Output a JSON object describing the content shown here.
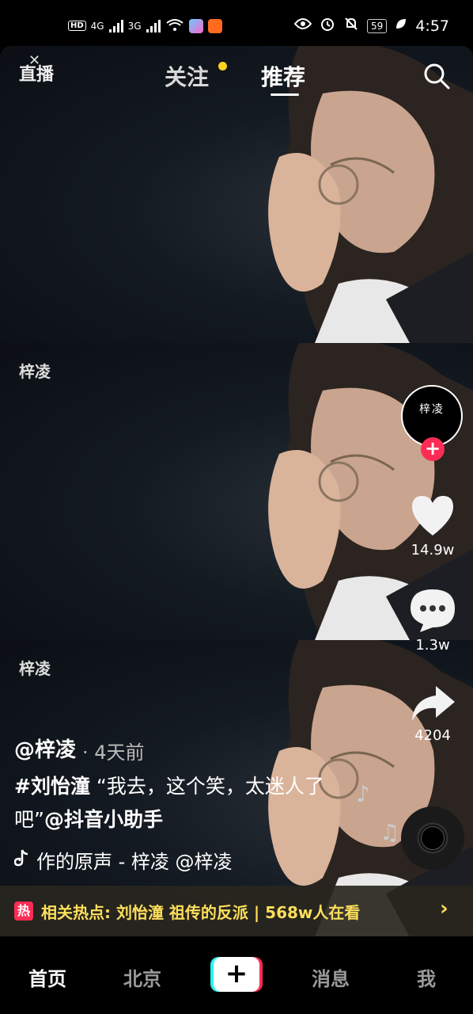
{
  "status_bar": {
    "hd": "HD",
    "net1": "4G",
    "net2": "3G",
    "battery": "59",
    "time": "4:57"
  },
  "top_nav": {
    "live": "直播",
    "follow": "关注",
    "recommend": "推荐"
  },
  "video": {
    "watermark": "梓凌"
  },
  "right_rail": {
    "avatar_text": "梓凌",
    "likes": "14.9w",
    "comments": "1.3w",
    "shares": "4204"
  },
  "caption": {
    "author": "@梓凌",
    "posted": "· 4天前",
    "hashtag": "#刘怡潼",
    "text": " “我去，这个笑，太迷人了吧”",
    "mention": "@抖音小助手",
    "music": "作的原声 - 梓凌    @梓凌"
  },
  "hot": {
    "badge": "热",
    "text": "相关热点: 刘怡潼 祖传的反派 | 568w人在看",
    "arrow": "›"
  },
  "bottom_nav": {
    "home": "首页",
    "city": "北京",
    "add": "+",
    "messages": "消息",
    "me": "我"
  }
}
